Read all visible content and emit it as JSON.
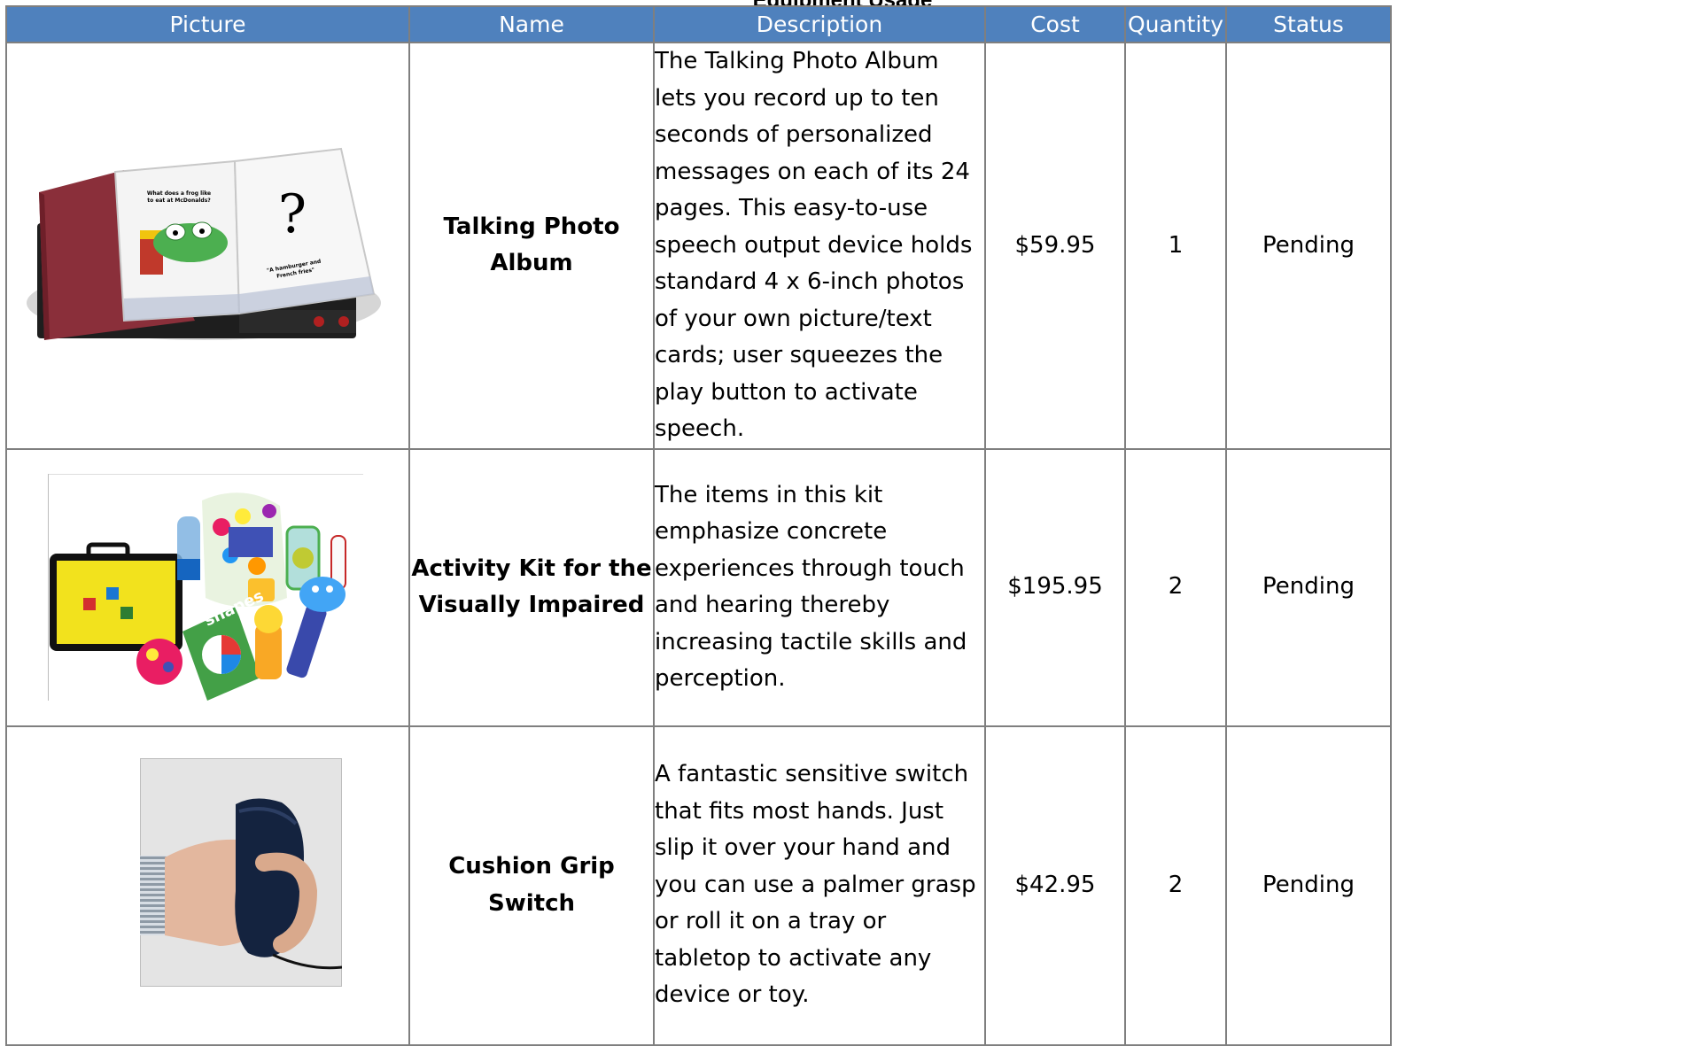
{
  "title": "Equipment Usage",
  "columns": {
    "picture": "Picture",
    "name": "Name",
    "description": "Description",
    "cost": "Cost",
    "quantity": "Quantity",
    "status": "Status"
  },
  "rows": [
    {
      "image": "talking-photo-album",
      "image_text": [
        "What does a frog like",
        "to eat at McDonalds?",
        "?",
        "\"A hamburger and",
        "French fries\""
      ],
      "name": "Talking Photo Album",
      "description": "The Talking Photo Album lets you record up to ten seconds of personalized messages on each of its 24 pages. This easy-to-use speech output device holds standard 4 x 6-inch photos of your own picture/text cards; user squeezes the play button to activate speech.",
      "cost": "$59.95",
      "quantity": "1",
      "status": "Pending"
    },
    {
      "image": "activity-kit",
      "image_text": [
        "shapes"
      ],
      "name": "Activity Kit for the Visually Impaired",
      "description": "The items in this kit emphasize concrete experiences through touch and hearing thereby increasing tactile skills and perception.",
      "cost": "$195.95",
      "quantity": "2",
      "status": "Pending"
    },
    {
      "image": "cushion-grip-switch",
      "image_text": [],
      "name": "Cushion Grip Switch",
      "description": "A fantastic sensitive switch that fits most hands. Just slip it over your hand and you can use a palmer grasp or roll it on a tray or tabletop to activate any device or toy.",
      "cost": "$42.95",
      "quantity": "2",
      "status": "Pending"
    }
  ],
  "colors": {
    "header_bg": "#4f81bd",
    "header_text": "#ffffff",
    "grid": "#7f7f7f"
  }
}
